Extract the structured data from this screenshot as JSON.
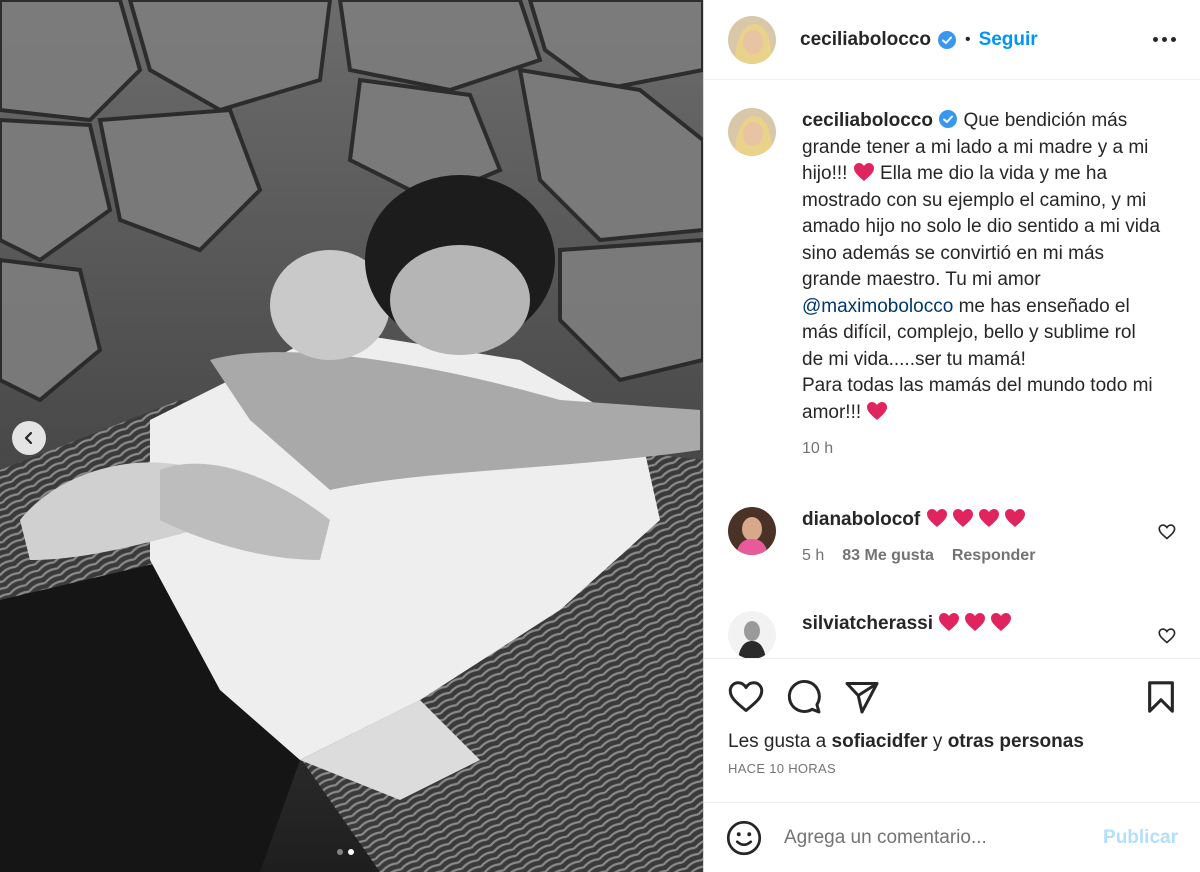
{
  "post": {
    "username": "ceciliabolocco",
    "follow_label": "Seguir",
    "separator": "•"
  },
  "caption": {
    "username": "ceciliabolocco",
    "text_1": "Que bendición más grande tener a mi lado a mi madre y a mi hijo!!! ",
    "text_2": " Ella me dio la vida y me ha mostrado con su ejemplo el camino, y mi amado hijo no solo le dio sentido a mi vida sino además se convirtió en mi más grande maestro. Tu mi amor ",
    "mention": "@maximobolocco",
    "text_3": " me has enseñado el más difícil, complejo, bello y sublime rol de mi vida.....ser tu mamá!",
    "text_4": "Para todas las mamás del mundo todo mi amor!!! ",
    "time": "10 h"
  },
  "comments": [
    {
      "username": "dianabolocof",
      "time": "5 h",
      "likes": "83 Me gusta",
      "reply": "Responder"
    },
    {
      "username": "silviatcherassi"
    }
  ],
  "likes": {
    "prefix": "Les gusta a ",
    "user": "sofiacidfer",
    "middle": " y ",
    "others": "otras personas",
    "timestamp": "HACE 10 HORAS"
  },
  "add_comment": {
    "placeholder": "Agrega un comentario...",
    "publish_label": "Publicar"
  },
  "colors": {
    "accent": "#0095f6",
    "heart": "#e0245e",
    "verified": "#3897f0"
  },
  "icons": [
    "chevron-left-icon",
    "verified-badge-icon",
    "more-icon",
    "heart-icon",
    "comment-icon",
    "share-icon",
    "bookmark-icon",
    "emoji-icon"
  ],
  "carousel": {
    "current": 2,
    "total": 2
  }
}
